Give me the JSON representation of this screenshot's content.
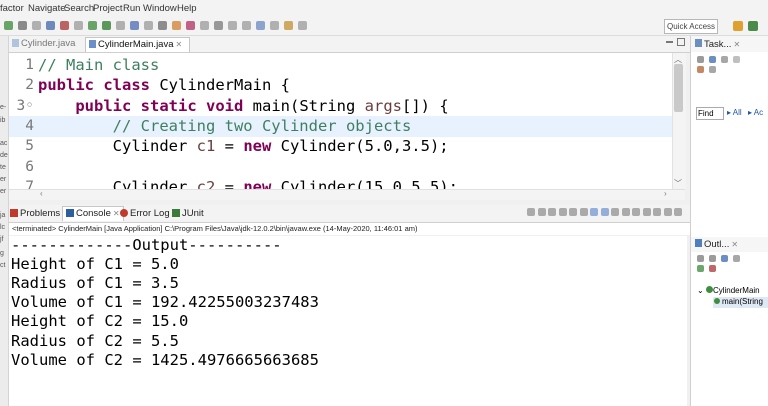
{
  "menu": [
    "factor",
    "Navigate",
    "Search",
    "Project",
    "Run",
    "Window",
    "Help"
  ],
  "toolbar": {
    "quick_access": "Quick Access"
  },
  "editor": {
    "tabs": [
      {
        "label": "Cylinder.java",
        "active": false
      },
      {
        "label": "CylinderMain.java",
        "active": true
      }
    ],
    "lines": [
      {
        "n": "1",
        "tokens": [
          {
            "t": "// Main class",
            "c": "cm"
          }
        ]
      },
      {
        "n": "2",
        "tokens": [
          {
            "t": "public",
            "c": "kw"
          },
          {
            "t": " "
          },
          {
            "t": "class",
            "c": "kw"
          },
          {
            "t": " CylinderMain {"
          }
        ]
      },
      {
        "n": "3◦",
        "tokens": [
          {
            "t": "    "
          },
          {
            "t": "public",
            "c": "kw"
          },
          {
            "t": " "
          },
          {
            "t": "static",
            "c": "kw"
          },
          {
            "t": " "
          },
          {
            "t": "void",
            "c": "kw"
          },
          {
            "t": " main(String "
          },
          {
            "t": "args",
            "c": "vn"
          },
          {
            "t": "[]) {"
          }
        ]
      },
      {
        "n": "4",
        "hl": true,
        "tokens": [
          {
            "t": "        "
          },
          {
            "t": "// Creating two Cylinder objects",
            "c": "cm"
          }
        ]
      },
      {
        "n": "5",
        "tokens": [
          {
            "t": "        Cylinder "
          },
          {
            "t": "c1",
            "c": "vn"
          },
          {
            "t": " = "
          },
          {
            "t": "new",
            "c": "kw"
          },
          {
            "t": " Cylinder(5.0,3.5);"
          }
        ]
      },
      {
        "n": "6",
        "tokens": []
      },
      {
        "n": "7",
        "tokens": [
          {
            "t": "        Cylinder "
          },
          {
            "t": "c2",
            "c": "vn"
          },
          {
            "t": " = "
          },
          {
            "t": "new",
            "c": "kw"
          },
          {
            "t": " Cylinder(15.0,5.5);"
          }
        ]
      }
    ]
  },
  "console": {
    "tabs": [
      {
        "label": "Problems",
        "icon_color": "#c0392b"
      },
      {
        "label": "Console",
        "icon_color": "#2c5f9e",
        "active": true
      },
      {
        "label": "Error Log",
        "icon_color": "#c0392b"
      },
      {
        "label": "JUnit",
        "icon_color": "#3a7a3a"
      }
    ],
    "status": "<terminated> CylinderMain [Java Application] C:\\Program Files\\Java\\jdk-12.0.2\\bin\\javaw.exe (14-May-2020, 11:46:01 am)",
    "output": [
      "-------------Output----------",
      "Height of C1 = 5.0",
      "Radius of C1 = 3.5",
      "Volume of C1 = 192.42255003237483",
      "Height of C2 = 15.0",
      "Radius of C2 = 5.5",
      "Volume of C2 = 1425.4976665663685"
    ]
  },
  "right_panel": {
    "tasks_title": "Task...",
    "find_label": "Find",
    "all_label": "▸ All",
    "ac_label": "▸ Ac",
    "outline_title": "Outl...",
    "outline_class": "CylinderMain",
    "outline_method": "main(String"
  },
  "left_strip": [
    "e-",
    "ib",
    "ac",
    "de",
    "te",
    "er",
    "er",
    "ja",
    "lc",
    "jf",
    "g",
    "ct"
  ]
}
